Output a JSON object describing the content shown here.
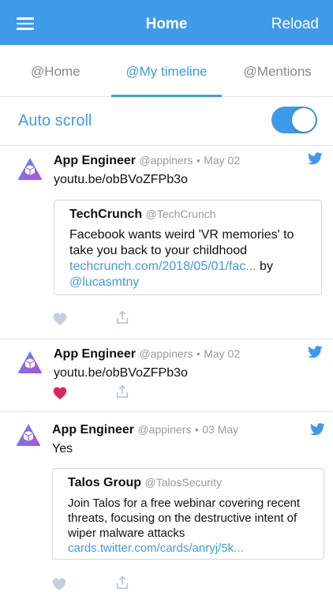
{
  "navbar": {
    "title": "Home",
    "reload_label": "Reload"
  },
  "tabs": [
    {
      "label": "@Home",
      "active": false
    },
    {
      "label": "@My timeline",
      "active": true
    },
    {
      "label": "@Mentions",
      "active": false
    }
  ],
  "auto_scroll": {
    "label": "Auto scroll",
    "enabled": true
  },
  "colors": {
    "accent": "#3f9ae9",
    "like_active": "#e0245e",
    "inactive_icon": "#b8c4cc"
  },
  "tweets": [
    {
      "author": "App Engineer",
      "handle": "@appiners",
      "separator": "•",
      "date": "May 02",
      "link": "youtu.be/obBVoZFPb3o",
      "liked": false,
      "quote": {
        "author": "TechCrunch",
        "handle": "@TechCrunch",
        "text": "Facebook wants weird 'VR memories' to take you back to your childhood",
        "link": "techcrunch.com/2018/05/01/fac...",
        "by": "by",
        "mention": "@lucasmtny"
      }
    },
    {
      "author": "App Engineer",
      "handle": "@appiners",
      "separator": "•",
      "date": "May 02",
      "link": "youtu.be/obBVoZFPb3o",
      "liked": true
    },
    {
      "author": "App Engineer",
      "handle": "@appiners",
      "separator": "•",
      "date": "03 May",
      "text": "Yes",
      "liked": false,
      "quote": {
        "author": "Talos Group",
        "handle": "@TalosSecurity",
        "text": "Join Talos for a free webinar covering recent threats, focusing on the destructive  intent of wiper malware attacks",
        "link": "cards.twitter.com/cards/anryj/5k..."
      }
    }
  ]
}
